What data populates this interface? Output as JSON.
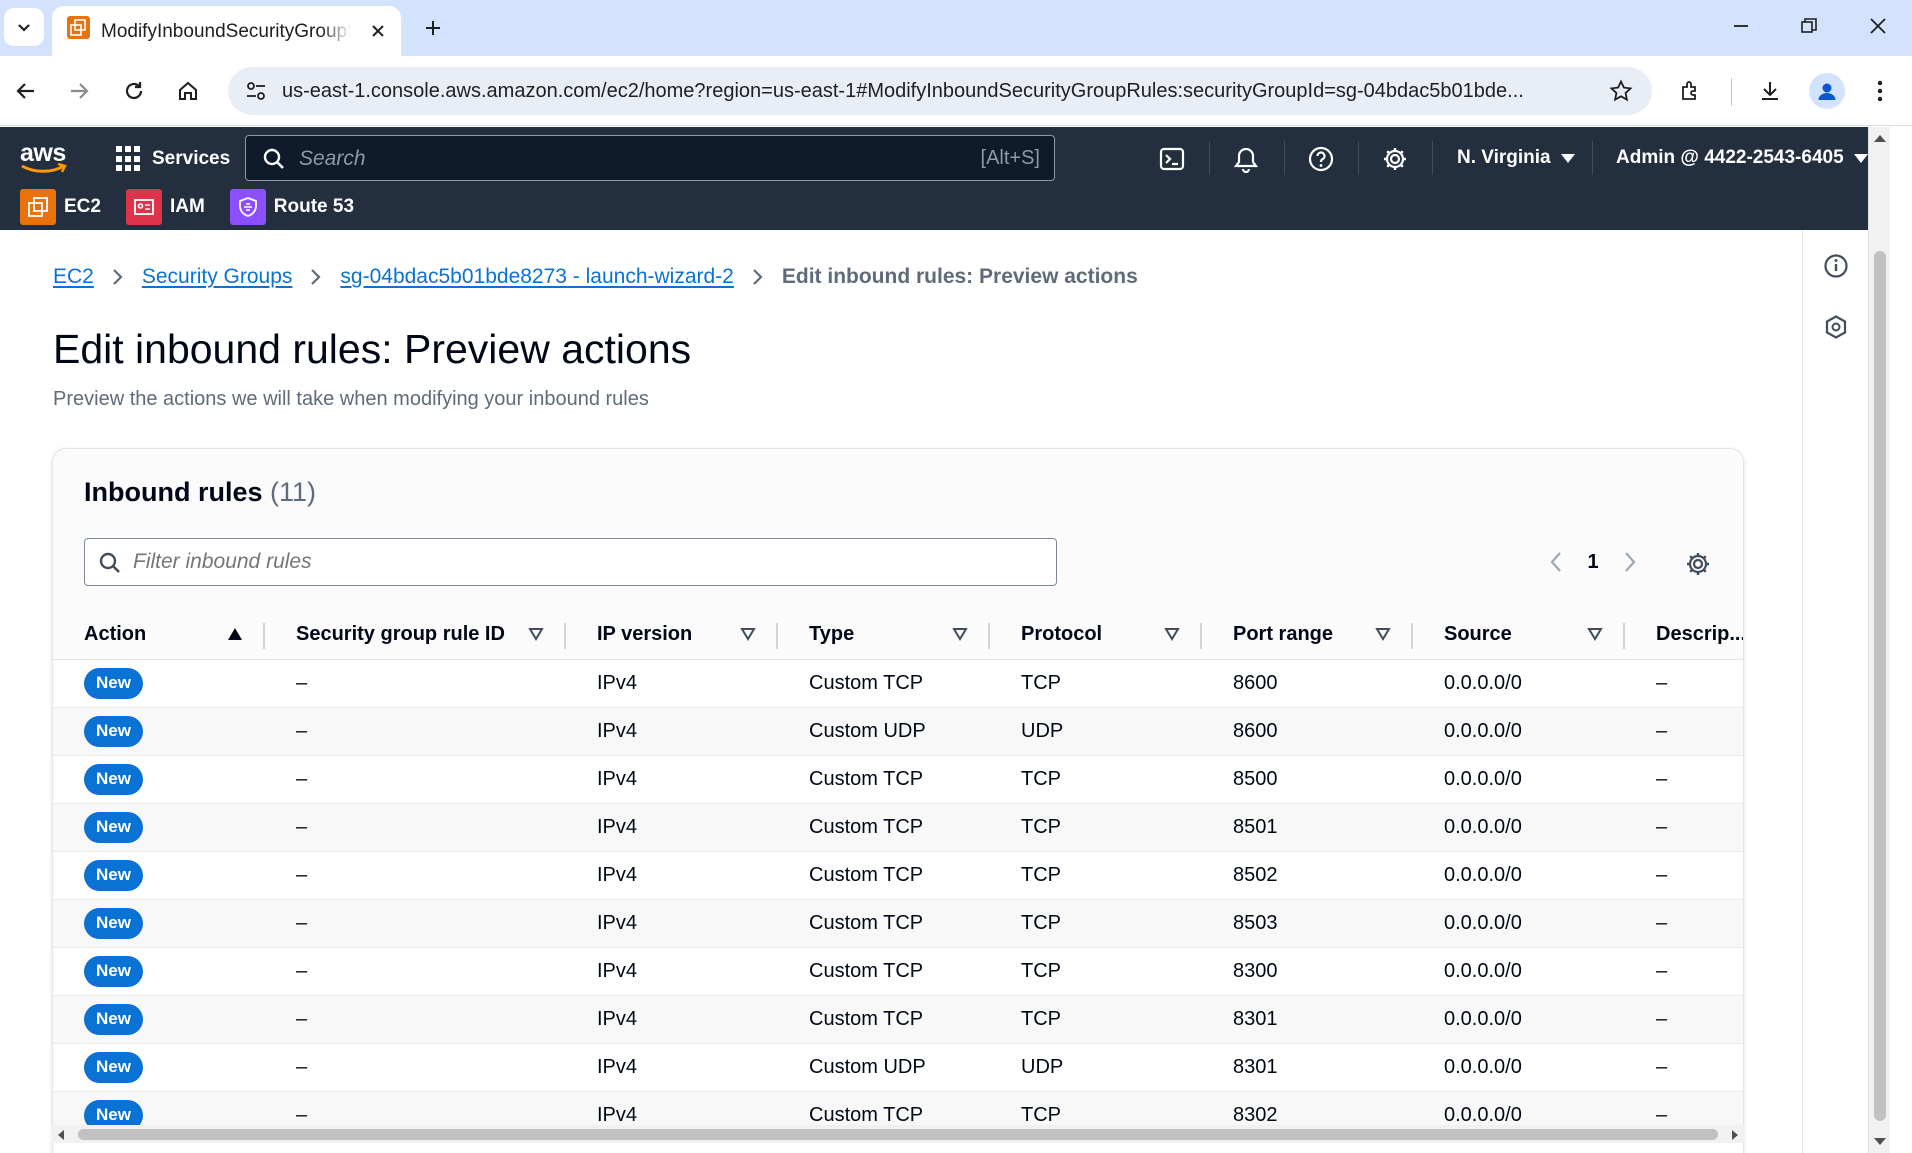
{
  "browser": {
    "tab_title": "ModifyInboundSecurityGroupRules",
    "url": "us-east-1.console.aws.amazon.com/ec2/home?region=us-east-1#ModifyInboundSecurityGroupRules:securityGroupId=sg-04bdac5b01bde..."
  },
  "aws": {
    "logo": "aws",
    "services_label": "Services",
    "search_placeholder": "Search",
    "search_shortcut": "[Alt+S]",
    "region": "N. Virginia",
    "account": "Admin @ 4422-2543-6405",
    "favorites": [
      {
        "label": "EC2",
        "color": "#e8730c"
      },
      {
        "label": "IAM",
        "color": "#dd344c"
      },
      {
        "label": "Route 53",
        "color": "#8c4fff"
      }
    ]
  },
  "breadcrumb": {
    "items": [
      "EC2",
      "Security Groups",
      "sg-04bdac5b01bde8273 - launch-wizard-2"
    ],
    "current": "Edit inbound rules: Preview actions"
  },
  "page": {
    "title": "Edit inbound rules: Preview actions",
    "description": "Preview the actions we will take when modifying your inbound rules"
  },
  "rules": {
    "title": "Inbound rules",
    "count": "(11)",
    "filter_placeholder": "Filter inbound rules",
    "page": "1",
    "columns": [
      "Action",
      "Security group rule ID",
      "IP version",
      "Type",
      "Protocol",
      "Port range",
      "Source",
      "Descrip..."
    ],
    "rows": [
      {
        "action": "New",
        "rule_id": "–",
        "ip_version": "IPv4",
        "type": "Custom TCP",
        "protocol": "TCP",
        "port_range": "8600",
        "source": "0.0.0.0/0",
        "description": "–"
      },
      {
        "action": "New",
        "rule_id": "–",
        "ip_version": "IPv4",
        "type": "Custom UDP",
        "protocol": "UDP",
        "port_range": "8600",
        "source": "0.0.0.0/0",
        "description": "–"
      },
      {
        "action": "New",
        "rule_id": "–",
        "ip_version": "IPv4",
        "type": "Custom TCP",
        "protocol": "TCP",
        "port_range": "8500",
        "source": "0.0.0.0/0",
        "description": "–"
      },
      {
        "action": "New",
        "rule_id": "–",
        "ip_version": "IPv4",
        "type": "Custom TCP",
        "protocol": "TCP",
        "port_range": "8501",
        "source": "0.0.0.0/0",
        "description": "–"
      },
      {
        "action": "New",
        "rule_id": "–",
        "ip_version": "IPv4",
        "type": "Custom TCP",
        "protocol": "TCP",
        "port_range": "8502",
        "source": "0.0.0.0/0",
        "description": "–"
      },
      {
        "action": "New",
        "rule_id": "–",
        "ip_version": "IPv4",
        "type": "Custom TCP",
        "protocol": "TCP",
        "port_range": "8503",
        "source": "0.0.0.0/0",
        "description": "–"
      },
      {
        "action": "New",
        "rule_id": "–",
        "ip_version": "IPv4",
        "type": "Custom TCP",
        "protocol": "TCP",
        "port_range": "8300",
        "source": "0.0.0.0/0",
        "description": "–"
      },
      {
        "action": "New",
        "rule_id": "–",
        "ip_version": "IPv4",
        "type": "Custom TCP",
        "protocol": "TCP",
        "port_range": "8301",
        "source": "0.0.0.0/0",
        "description": "–"
      },
      {
        "action": "New",
        "rule_id": "–",
        "ip_version": "IPv4",
        "type": "Custom UDP",
        "protocol": "UDP",
        "port_range": "8301",
        "source": "0.0.0.0/0",
        "description": "–"
      },
      {
        "action": "New",
        "rule_id": "–",
        "ip_version": "IPv4",
        "type": "Custom TCP",
        "protocol": "TCP",
        "port_range": "8302",
        "source": "0.0.0.0/0",
        "description": "–"
      }
    ]
  },
  "colors": {
    "aws_header": "#232f3e",
    "link": "#0972d3",
    "badge": "#0972d3",
    "browser_frame": "#d3e3fd"
  }
}
